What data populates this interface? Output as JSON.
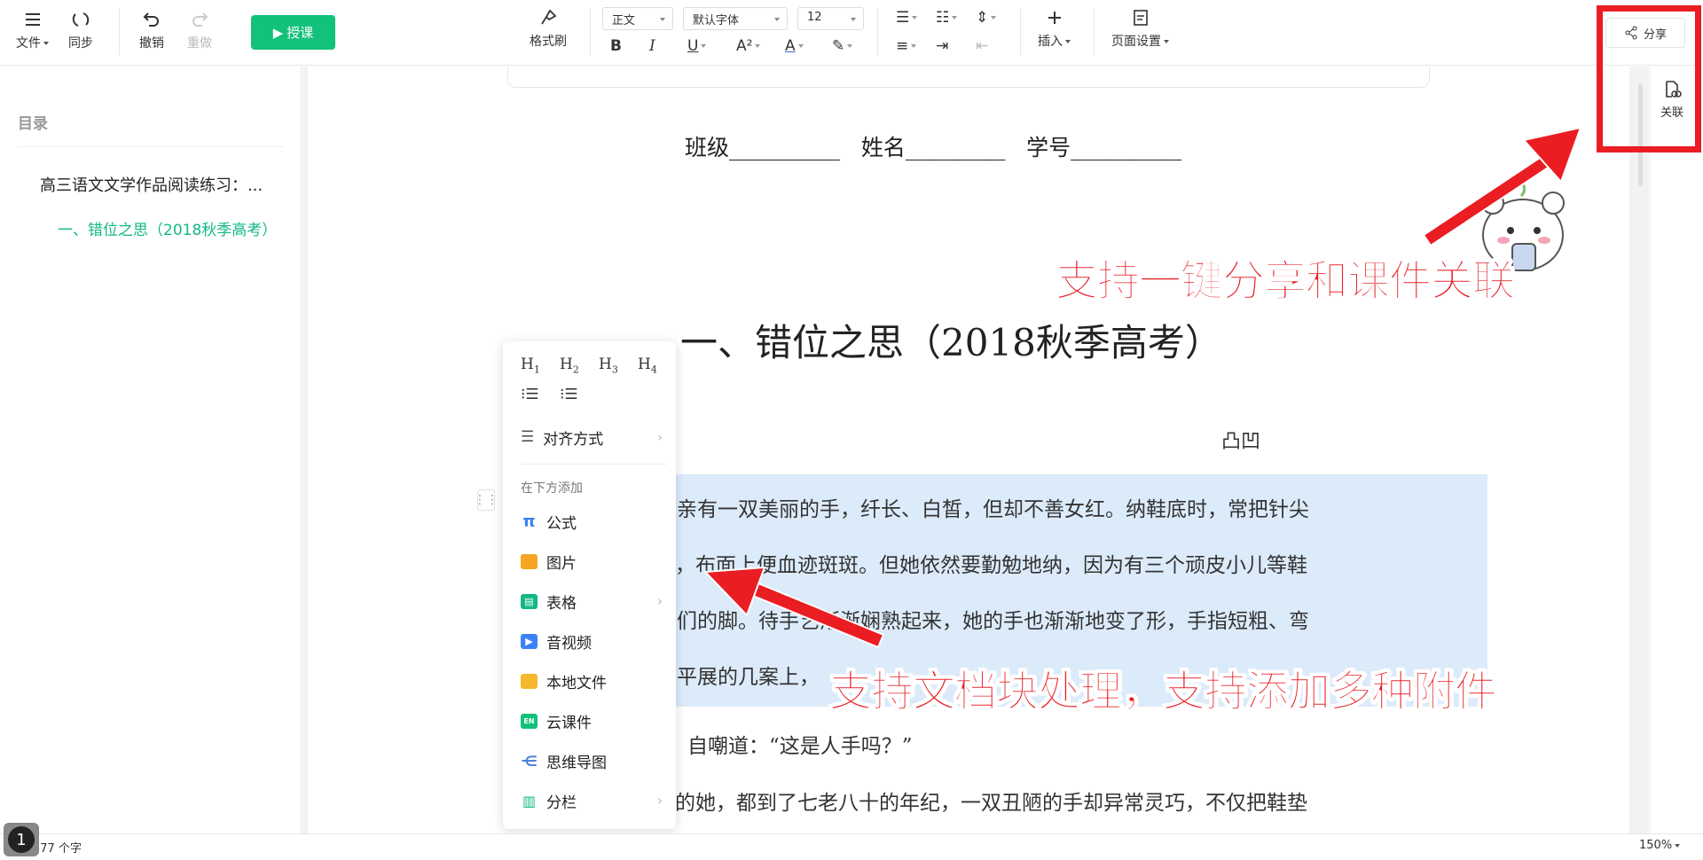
{
  "toolbar": {
    "file": "文件",
    "sync": "同步",
    "undo": "撤销",
    "redo": "重做",
    "teach": "授课",
    "format_painter": "格式刷",
    "style_select": "正文",
    "font_select": "默认字体",
    "size_select": "12",
    "insert": "插入",
    "page_setup": "页面设置",
    "share": "分享",
    "link": "关联"
  },
  "sidebar": {
    "title": "目录",
    "items": [
      {
        "label": "高三语文文学作品阅读练习：..."
      },
      {
        "label": "一、错位之思（2018秋季高考）"
      }
    ]
  },
  "document": {
    "info_line": "班级__________   姓名_________   学号__________",
    "heading": "一、错位之思（2018秋季高考）",
    "author": "凸凹",
    "paragraphs": [
      "亲有一双美丽的手，纤长、白皙，但却不善女红。纳鞋底时，常把针尖",
      "，布面上便血迹斑斑。但她依然要勤勉地纳，因为有三个顽皮小儿等鞋",
      "们的脚。待手艺渐渐娴熟起来，她的手也渐渐地变了形，手指短粗、弯",
      "平展的几案上，",
      "，自嘲道：“这是人手吗？”",
      "的她，都到了七老八十的年纪，一双丑陋的手却异常灵巧，不仅把鞋垫"
    ]
  },
  "popup_menu": {
    "headings": [
      "H",
      "H",
      "H",
      "H"
    ],
    "heading_levels": [
      "1",
      "2",
      "3",
      "4"
    ],
    "align": "对齐方式",
    "add_below": "在下方添加",
    "items": [
      {
        "label": "公式",
        "icon": "pi-icon",
        "color": "#3b82f6"
      },
      {
        "label": "图片",
        "icon": "image-icon",
        "color": "#f5a623"
      },
      {
        "label": "表格",
        "icon": "table-icon",
        "color": "#12b886"
      },
      {
        "label": "音视频",
        "icon": "video-icon",
        "color": "#3b82f6"
      },
      {
        "label": "本地文件",
        "icon": "folder-icon",
        "color": "#f5b82e"
      },
      {
        "label": "云课件",
        "icon": "cloud-courseware-icon",
        "color": "#12c17a"
      },
      {
        "label": "思维导图",
        "icon": "mindmap-icon",
        "color": "#4a7bd8"
      },
      {
        "label": "分栏",
        "icon": "columns-icon",
        "color": "#12b886"
      }
    ]
  },
  "status": {
    "word_count": "577 个字",
    "zoom": "150%",
    "badge": "1"
  },
  "annotations": {
    "top": "支持一键分享和课件关联",
    "middle": "支持文档块处理，支持添加多种附件",
    "color": "#e81c24"
  }
}
